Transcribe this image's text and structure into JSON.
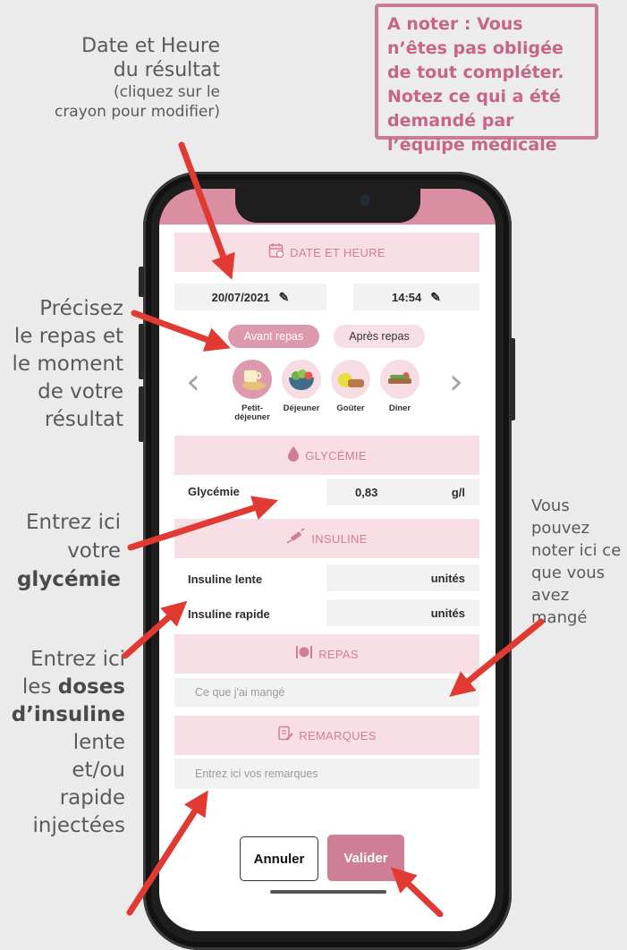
{
  "annotations": {
    "date_line1": "Date et Heure",
    "date_line2": "du résultat",
    "date_line3": "(cliquez sur le",
    "date_line4": "crayon pour modifier)",
    "note": "A noter : Vous n’êtes pas obligée de tout compléter. Notez ce qui a été demandé par l’équipe médicale",
    "repas_lines": [
      "Précisez",
      "le repas et",
      "le moment",
      "de votre",
      "résultat"
    ],
    "glyc_line1": "Entrez ici",
    "glyc_line2": "votre",
    "glyc_bold": "glycémie",
    "mange_lines": [
      "Vous",
      "pouvez",
      "noter ici ce",
      "que vous",
      "avez mangé"
    ],
    "doses_line1": "Entrez ici",
    "doses_les": "les ",
    "doses_bold1": "doses",
    "doses_bold2": "d’insuline",
    "doses_line4": "lente",
    "doses_line5": "et/ou",
    "doses_line6": "rapide",
    "doses_line7": "injectées"
  },
  "app": {
    "date_section": "DATE ET HEURE",
    "date_value": "20/07/2021",
    "time_value": "14:54",
    "timing_options": [
      "Avant repas",
      "Après repas"
    ],
    "timing_selected": "Avant repas",
    "meals": [
      "Petit-\ndéjeuner",
      "Déjeuner",
      "Goûter",
      "Dîner"
    ],
    "meal_selected": "Petit-déjeuner",
    "glycemie_section": "GLYCÉMIE",
    "glycemie_label": "Glycémie",
    "glycemie_value": "0,83",
    "glycemie_unit": "g/l",
    "insuline_section": "INSULINE",
    "insuline_lente_label": "Insuline lente",
    "insuline_rapide_label": "Insuline rapide",
    "insuline_unit": "unités",
    "repas_section": "REPAS",
    "repas_placeholder": "Ce que j'ai mangé",
    "remarques_section": "REMARQUES",
    "remarques_placeholder": "Entrez ici vos remarques",
    "cancel_label": "Annuler",
    "validate_label": "Valider"
  },
  "colors": {
    "accent": "#cf7f95",
    "band": "#f8dfe6",
    "arrow": "#e03a32",
    "note_border": "#c97d93"
  }
}
